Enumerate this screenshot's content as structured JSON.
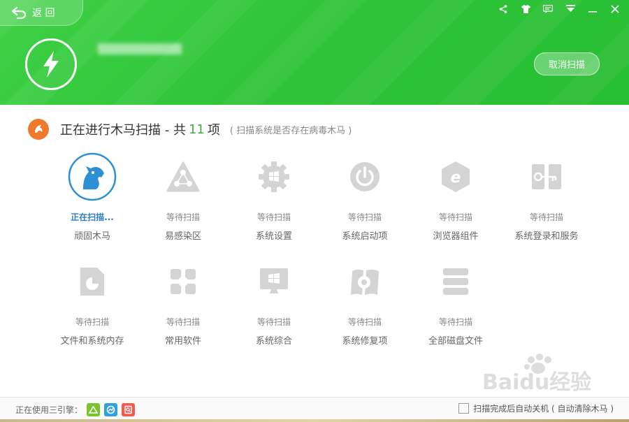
{
  "header": {
    "back_label": "返 回",
    "cancel_label": "取消扫描",
    "window_controls": [
      "share-icon",
      "skin-icon",
      "message-icon",
      "menu-icon",
      "minimize-icon",
      "close-icon"
    ]
  },
  "scan": {
    "title_prefix": "正在进行木马扫描 - 共",
    "count": "11",
    "title_suffix": "项",
    "hint": "( 扫描系统是否存在病毒木马 )"
  },
  "items": [
    {
      "status": "正在扫描...",
      "name": "顽固木马",
      "icon": "trojan-horse-icon",
      "active": true
    },
    {
      "status": "等待扫描",
      "name": "易感染区",
      "icon": "warning-triangle-icon",
      "active": false
    },
    {
      "status": "等待扫描",
      "name": "系统设置",
      "icon": "settings-gear-icon",
      "active": false
    },
    {
      "status": "等待扫描",
      "name": "系统启动项",
      "icon": "power-icon",
      "active": false
    },
    {
      "status": "等待扫描",
      "name": "浏览器组件",
      "icon": "browser-icon",
      "active": false
    },
    {
      "status": "等待扫描",
      "name": "系统登录和服务",
      "icon": "login-service-icon",
      "active": false
    },
    {
      "status": "等待扫描",
      "name": "文件和系统内存",
      "icon": "file-memory-icon",
      "active": false
    },
    {
      "status": "等待扫描",
      "name": "常用软件",
      "icon": "software-icon",
      "active": false
    },
    {
      "status": "等待扫描",
      "name": "系统综合",
      "icon": "system-monitor-icon",
      "active": false
    },
    {
      "status": "等待扫描",
      "name": "系统修复项",
      "icon": "system-repair-icon",
      "active": false
    },
    {
      "status": "等待扫描",
      "name": "全部磁盘文件",
      "icon": "disk-stack-icon",
      "active": false
    }
  ],
  "footer": {
    "engines_label": "正在使用三引擎：",
    "engines": [
      "cloud-engine-icon",
      "qvm-engine-icon",
      "local-engine-icon"
    ],
    "auto_shutdown_label": "扫描完成后自动关机 ( 自动清除木马 )"
  },
  "colors": {
    "header_green": "#2fc43a",
    "accent_blue": "#2d7fc1",
    "count_green": "#3bb23f",
    "title_icon_orange": "#f07a2c"
  },
  "watermark": "Baidu经验"
}
